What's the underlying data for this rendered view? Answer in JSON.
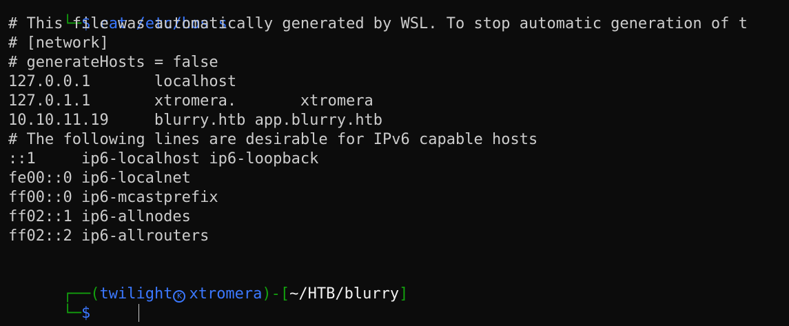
{
  "terminal": {
    "previous_prompt_corner": "└─",
    "previous_prompt_symbol": "$",
    "previous_command": "cat /etc/hosts",
    "output_lines": [
      "# This file was automatically generated by WSL. To stop automatic generation of t",
      "# [network]",
      "# generateHosts = false",
      "127.0.0.1       localhost",
      "127.0.1.1       xtromera.       xtromera",
      "10.10.11.19     blurry.htb app.blurry.htb",
      "# The following lines are desirable for IPv6 capable hosts",
      "::1     ip6-localhost ip6-loopback",
      "fe00::0 ip6-localnet",
      "ff00::0 ip6-mcastprefix",
      "ff02::1 ip6-allnodes",
      "ff02::2 ip6-allrouters"
    ],
    "prompt": {
      "top_corner": "┌──",
      "open_paren": "(",
      "user": "twilight",
      "host_icon": "skull-icon",
      "host": "xtromera",
      "close_paren": ")",
      "separator": "-",
      "open_bracket": "[",
      "path": "~/HTB/blurry",
      "close_bracket": "]",
      "bottom_corner": "└─",
      "symbol": "$",
      "input_value": ""
    },
    "colors": {
      "background": "#0c0c0c",
      "text": "#cccccc",
      "prompt_blue": "#3b78ff",
      "prompt_green": "#13a10e"
    }
  }
}
